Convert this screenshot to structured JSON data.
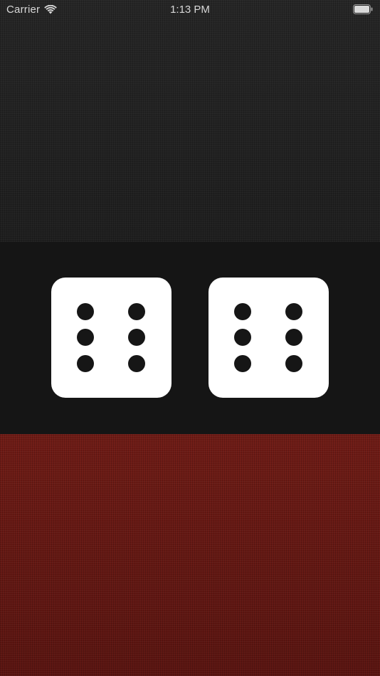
{
  "status_bar": {
    "carrier": "Carrier",
    "time": "1:13 PM",
    "wifi_icon": "wifi-icon",
    "battery_icon": "battery-icon"
  },
  "dice": [
    {
      "name": "left-die",
      "value": 6
    },
    {
      "name": "right-die",
      "value": 6
    }
  ],
  "colors": {
    "top_panel": "#232323",
    "middle_band": "#151515",
    "bottom_panel": "#6e1a14",
    "die_face": "#ffffff",
    "pip": "#161616"
  }
}
